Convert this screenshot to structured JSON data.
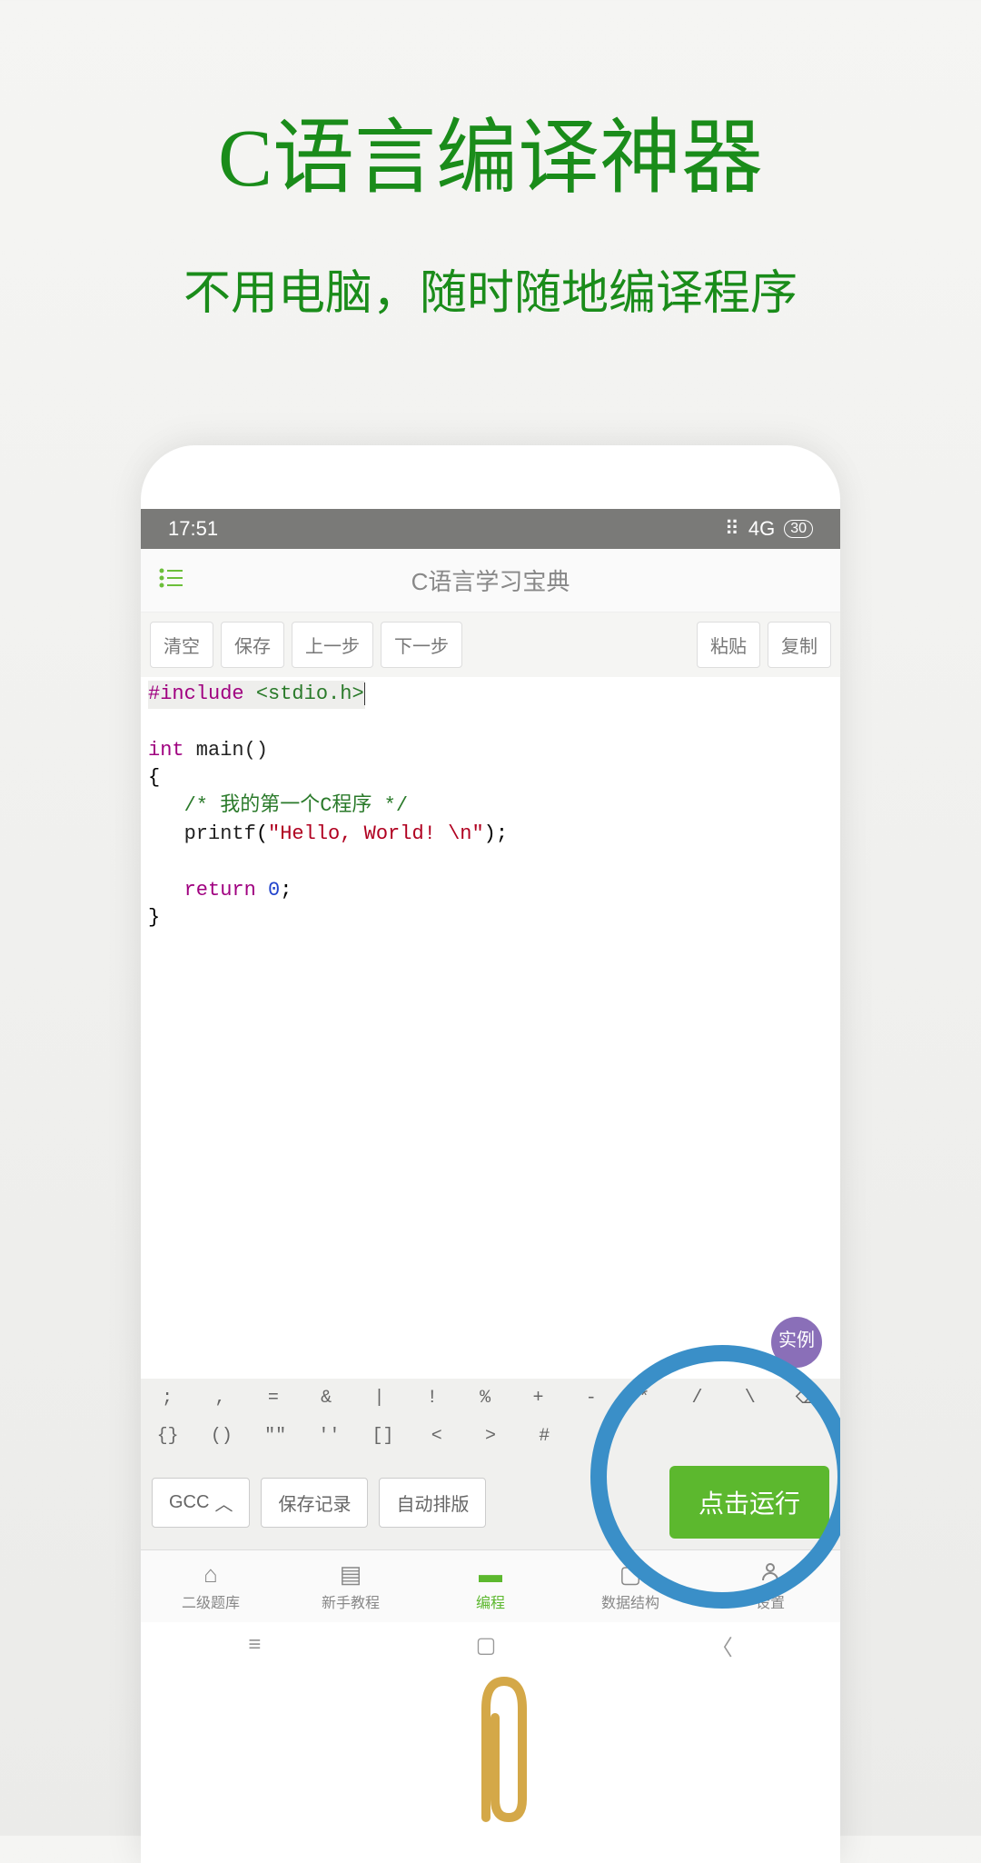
{
  "hero": {
    "title": "C语言编译神器",
    "subtitle": "不用电脑，随时随地编译程序"
  },
  "status": {
    "time": "17:51",
    "network": "4G",
    "battery": "30"
  },
  "header": {
    "title": "C语言学习宝典"
  },
  "toolbar": {
    "clear": "清空",
    "save": "保存",
    "undo": "上一步",
    "redo": "下一步",
    "paste": "粘贴",
    "copy": "复制"
  },
  "code": {
    "include": "#include",
    "header": "<stdio.h>",
    "int": "int",
    "main": " main()",
    "brace_open": "{",
    "comment": "/* 我的第一个C程序 */",
    "printf": "printf",
    "lparen": "(",
    "string": "\"Hello, World! \\n\"",
    "rparen_semi": ");",
    "return": "return",
    "zero": "0",
    "semi": ";",
    "brace_close": "}"
  },
  "example_badge": "实例",
  "symbols_row1": [
    ";",
    ",",
    "=",
    "&",
    "|",
    "!",
    "%",
    "+",
    "-",
    "*",
    "/",
    "\\",
    "⌫"
  ],
  "symbols_row2": [
    "{}",
    "()",
    "\"\"",
    "''",
    "[]",
    "<",
    ">",
    "#",
    "."
  ],
  "bottom": {
    "gcc": "GCC",
    "save_record": "保存记录",
    "auto_format": "自动排版",
    "run": "点击运行"
  },
  "nav": [
    {
      "label": "二级题库"
    },
    {
      "label": "新手教程"
    },
    {
      "label": "编程"
    },
    {
      "label": "数据结构"
    },
    {
      "label": "设置"
    }
  ]
}
